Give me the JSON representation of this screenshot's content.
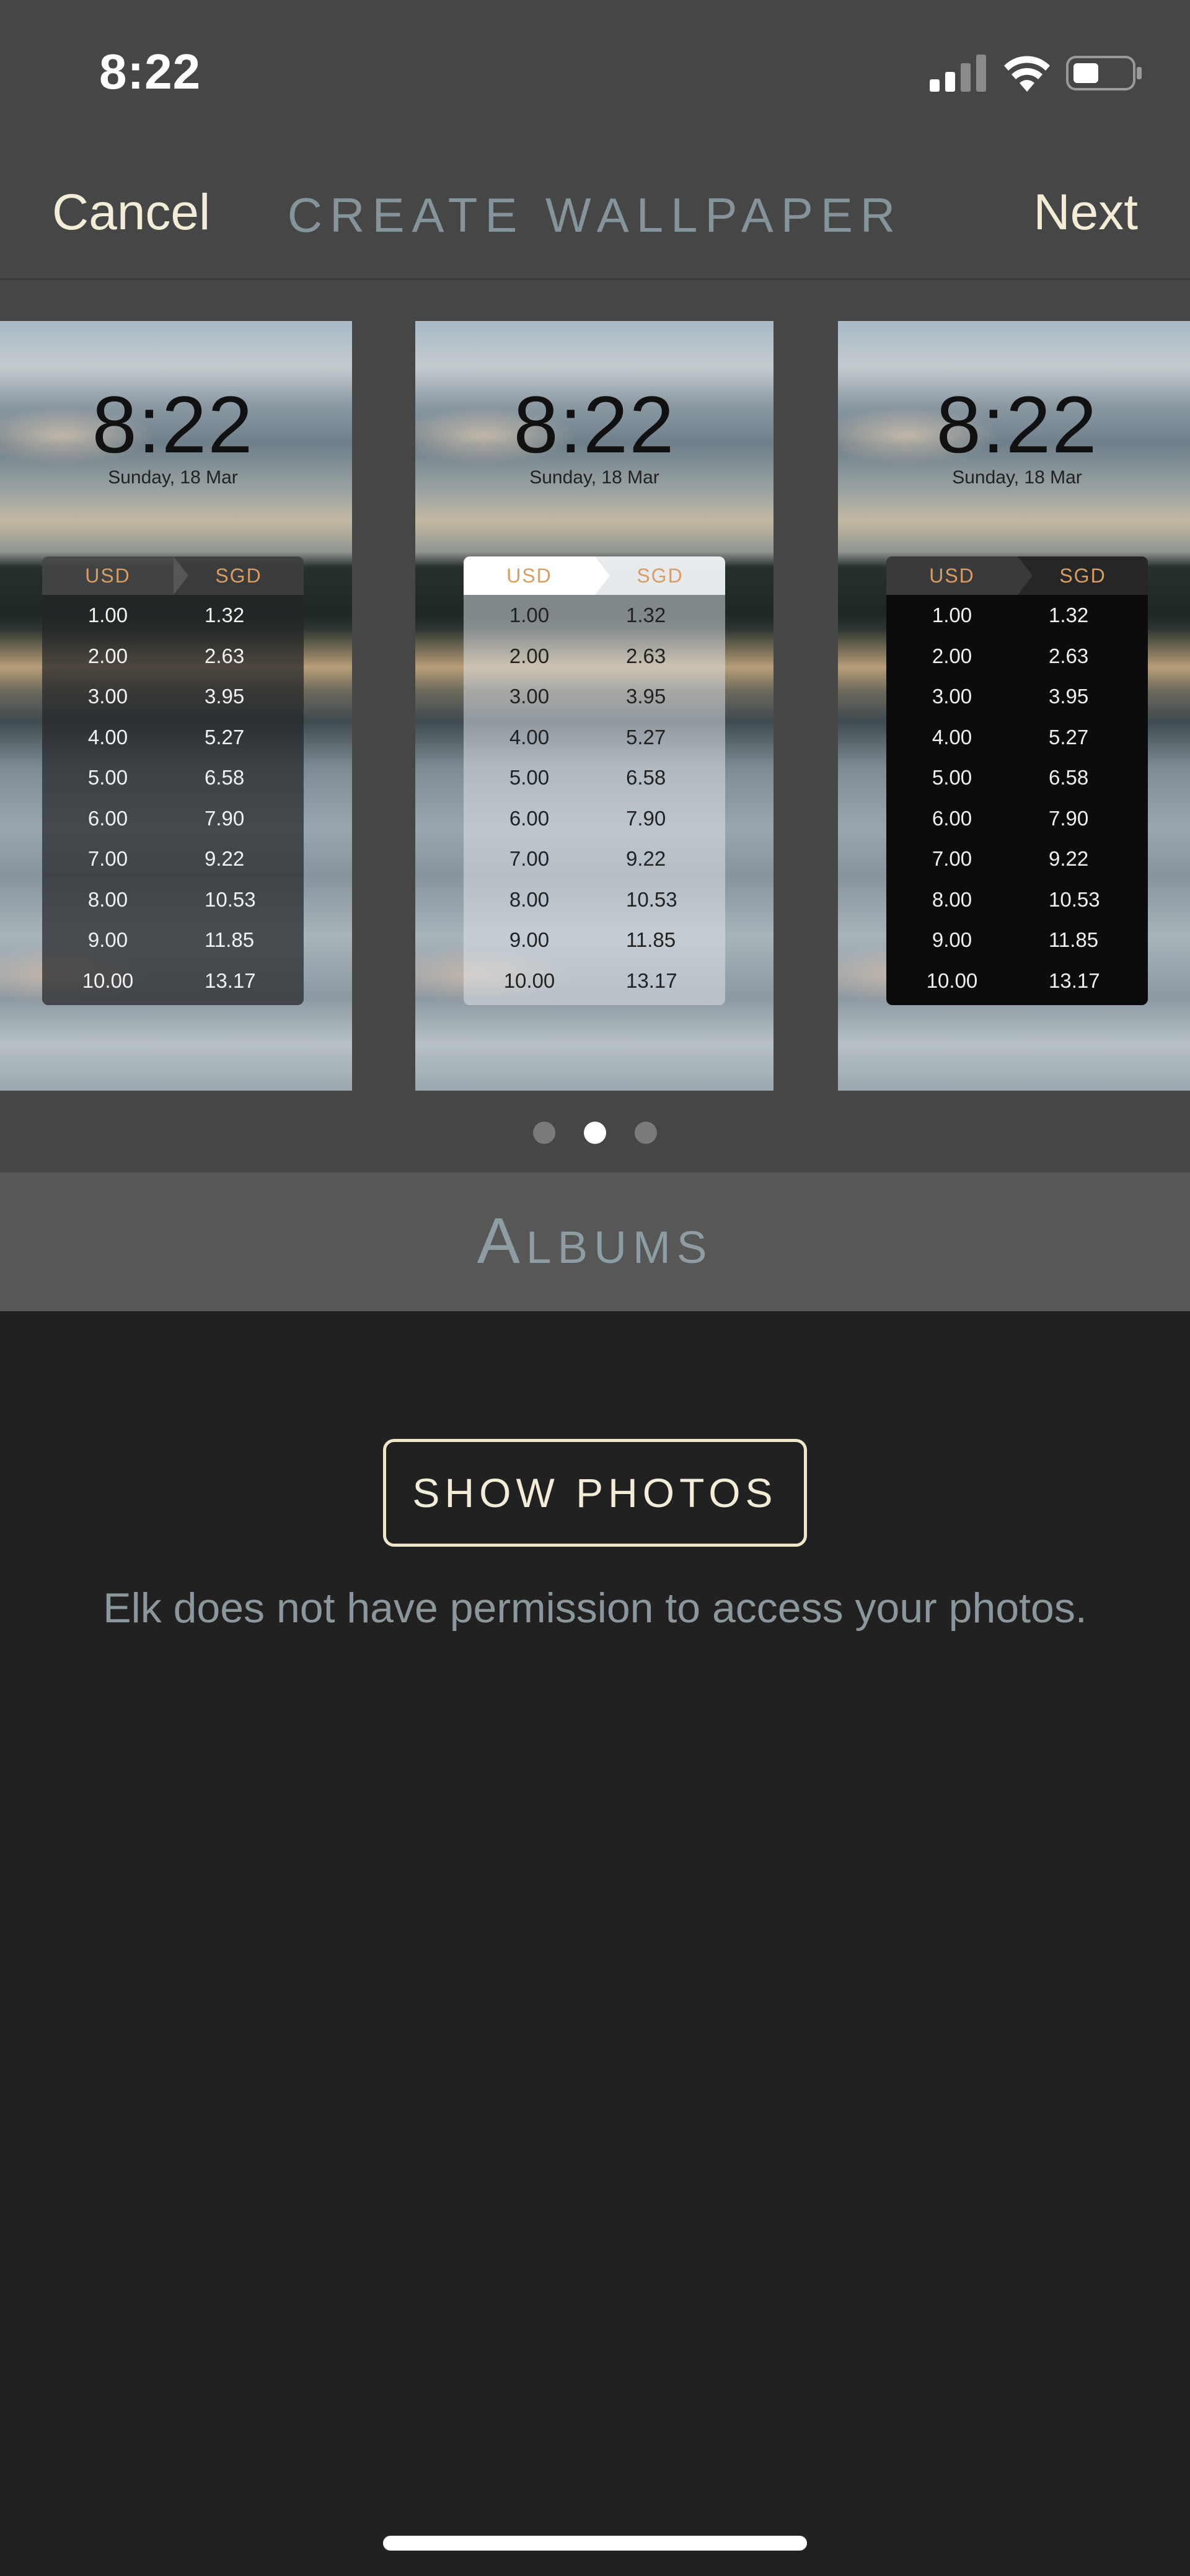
{
  "status_bar": {
    "time": "8:22",
    "signal_icon": "cellular-signal-icon",
    "wifi_icon": "wifi-icon",
    "battery_icon": "battery-icon",
    "battery_level": 0.45
  },
  "nav": {
    "cancel_label": "Cancel",
    "title": "CREATE WALLPAPER",
    "next_label": "Next"
  },
  "wallpapers": [
    {
      "style": "dark",
      "time": "8:22",
      "date": "Sunday, 18 Mar",
      "from_currency": "USD",
      "to_currency": "SGD",
      "rows": [
        [
          "1.00",
          "1.32"
        ],
        [
          "2.00",
          "2.63"
        ],
        [
          "3.00",
          "3.95"
        ],
        [
          "4.00",
          "5.27"
        ],
        [
          "5.00",
          "6.58"
        ],
        [
          "6.00",
          "7.90"
        ],
        [
          "7.00",
          "9.22"
        ],
        [
          "8.00",
          "10.53"
        ],
        [
          "9.00",
          "11.85"
        ],
        [
          "10.00",
          "13.17"
        ]
      ]
    },
    {
      "style": "light",
      "time": "8:22",
      "date": "Sunday, 18 Mar",
      "from_currency": "USD",
      "to_currency": "SGD",
      "rows": [
        [
          "1.00",
          "1.32"
        ],
        [
          "2.00",
          "2.63"
        ],
        [
          "3.00",
          "3.95"
        ],
        [
          "4.00",
          "5.27"
        ],
        [
          "5.00",
          "6.58"
        ],
        [
          "6.00",
          "7.90"
        ],
        [
          "7.00",
          "9.22"
        ],
        [
          "8.00",
          "10.53"
        ],
        [
          "9.00",
          "11.85"
        ],
        [
          "10.00",
          "13.17"
        ]
      ]
    },
    {
      "style": "black",
      "time": "8:22",
      "date": "Sunday, 18 Mar",
      "from_currency": "USD",
      "to_currency": "SGD",
      "rows": [
        [
          "1.00",
          "1.32"
        ],
        [
          "2.00",
          "2.63"
        ],
        [
          "3.00",
          "3.95"
        ],
        [
          "4.00",
          "5.27"
        ],
        [
          "5.00",
          "6.58"
        ],
        [
          "6.00",
          "7.90"
        ],
        [
          "7.00",
          "9.22"
        ],
        [
          "8.00",
          "10.53"
        ],
        [
          "9.00",
          "11.85"
        ],
        [
          "10.00",
          "13.17"
        ]
      ]
    }
  ],
  "page_indicator": {
    "count": 3,
    "active": 1
  },
  "albums": {
    "title": "Albums"
  },
  "content": {
    "show_photos_label": "SHOW PHOTOS",
    "permission_message": "Elk does not have permission to access your photos."
  },
  "colors": {
    "accent": "#f3ecd6",
    "title_grey": "#85949a",
    "currency_header": "#d79d62",
    "background": "#212121",
    "bar": "#464646"
  }
}
